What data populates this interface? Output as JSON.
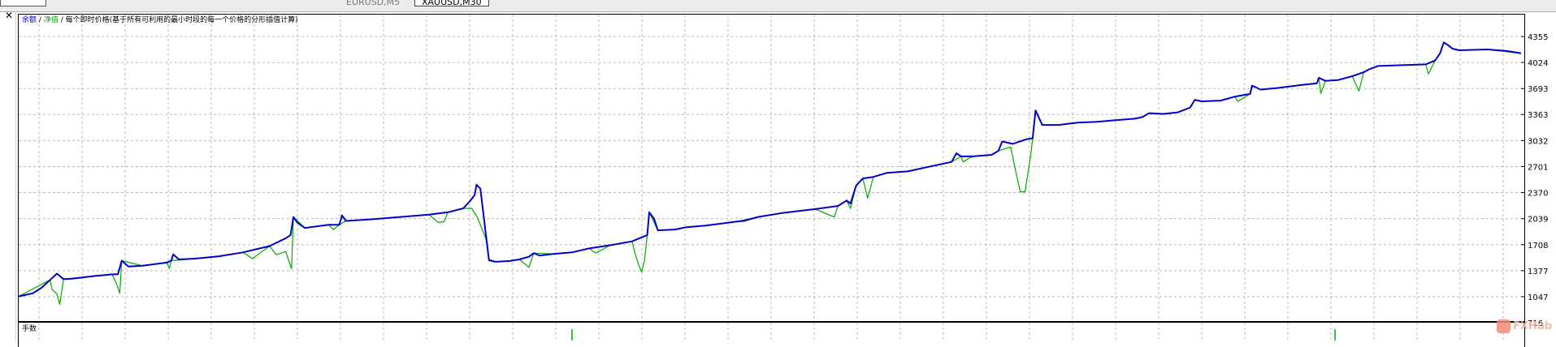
{
  "tabs": [
    {
      "label": "EURUSD,M5",
      "active": false
    },
    {
      "label": "XAUUSD,M30",
      "active": true
    }
  ],
  "close_icon": "✕",
  "legend": {
    "balance_label": "余额",
    "separator": "/",
    "equity_label": "净值",
    "description": "每个即时价格(基于所有可利用的最小时段的每一个价格的分形插值计算)",
    "balance_color": "#0000cc",
    "equity_color": "#00aa00",
    "text_color": "#000000"
  },
  "subwindow": {
    "title": "手数"
  },
  "watermark": {
    "text": "FXHub"
  },
  "chart_data": {
    "type": "line",
    "title": "",
    "xlabel": "",
    "ylabel": "",
    "ylim": [
      716,
      4355
    ],
    "yticks": [
      4355,
      4024,
      3693,
      3363,
      3032,
      2701,
      2370,
      2039,
      1708,
      1377,
      1047,
      716
    ],
    "grid": true,
    "legend_placement": "top-left",
    "x_unit": "trade sequence",
    "xlim": [
      0,
      1000
    ],
    "series": [
      {
        "name": "余额",
        "color": "#0000cc",
        "points": [
          [
            0,
            1050
          ],
          [
            15,
            1090
          ],
          [
            24,
            1160
          ],
          [
            33,
            1260
          ],
          [
            40,
            1340
          ],
          [
            47,
            1270
          ],
          [
            56,
            1275
          ],
          [
            80,
            1310
          ],
          [
            98,
            1330
          ],
          [
            104,
            1330
          ],
          [
            108,
            1505
          ],
          [
            115,
            1430
          ],
          [
            130,
            1440
          ],
          [
            155,
            1480
          ],
          [
            160,
            1505
          ],
          [
            162,
            1585
          ],
          [
            168,
            1520
          ],
          [
            185,
            1530
          ],
          [
            210,
            1560
          ],
          [
            235,
            1610
          ],
          [
            263,
            1690
          ],
          [
            280,
            1790
          ],
          [
            285,
            1830
          ],
          [
            288,
            2060
          ],
          [
            292,
            1990
          ],
          [
            300,
            1920
          ],
          [
            325,
            1960
          ],
          [
            336,
            1960
          ],
          [
            339,
            2080
          ],
          [
            343,
            2010
          ],
          [
            370,
            2030
          ],
          [
            400,
            2060
          ],
          [
            430,
            2090
          ],
          [
            450,
            2120
          ],
          [
            466,
            2170
          ],
          [
            473,
            2260
          ],
          [
            478,
            2340
          ],
          [
            480,
            2470
          ],
          [
            484,
            2420
          ],
          [
            493,
            1510
          ],
          [
            500,
            1490
          ],
          [
            515,
            1500
          ],
          [
            525,
            1520
          ],
          [
            535,
            1555
          ],
          [
            540,
            1600
          ],
          [
            546,
            1570
          ],
          [
            560,
            1590
          ],
          [
            580,
            1610
          ],
          [
            598,
            1660
          ],
          [
            620,
            1700
          ],
          [
            643,
            1750
          ],
          [
            653,
            1800
          ],
          [
            659,
            1830
          ],
          [
            661,
            2120
          ],
          [
            666,
            2040
          ],
          [
            670,
            1890
          ],
          [
            688,
            1900
          ],
          [
            700,
            1930
          ],
          [
            720,
            1950
          ],
          [
            752,
            2000
          ],
          [
            760,
            2010
          ],
          [
            775,
            2060
          ],
          [
            800,
            2110
          ],
          [
            835,
            2160
          ],
          [
            859,
            2200
          ],
          [
            868,
            2270
          ],
          [
            872,
            2230
          ],
          [
            878,
            2460
          ],
          [
            885,
            2550
          ],
          [
            896,
            2570
          ],
          [
            910,
            2620
          ],
          [
            932,
            2640
          ],
          [
            955,
            2700
          ],
          [
            978,
            2760
          ],
          [
            983,
            2870
          ],
          [
            988,
            2830
          ],
          [
            1000,
            2830
          ],
          [
            1020,
            2850
          ],
          [
            1027,
            2900
          ],
          [
            1031,
            3020
          ],
          [
            1042,
            2990
          ],
          [
            1057,
            3050
          ],
          [
            1063,
            3060
          ],
          [
            1066,
            3415
          ],
          [
            1073,
            3230
          ],
          [
            1090,
            3230
          ],
          [
            1110,
            3260
          ],
          [
            1130,
            3270
          ],
          [
            1150,
            3290
          ],
          [
            1170,
            3310
          ],
          [
            1178,
            3330
          ],
          [
            1185,
            3380
          ],
          [
            1200,
            3370
          ],
          [
            1215,
            3390
          ],
          [
            1228,
            3450
          ],
          [
            1233,
            3550
          ],
          [
            1240,
            3530
          ],
          [
            1260,
            3540
          ],
          [
            1275,
            3590
          ],
          [
            1291,
            3625
          ],
          [
            1293,
            3730
          ],
          [
            1302,
            3680
          ],
          [
            1320,
            3700
          ],
          [
            1345,
            3740
          ],
          [
            1361,
            3760
          ],
          [
            1363,
            3830
          ],
          [
            1370,
            3790
          ],
          [
            1383,
            3800
          ],
          [
            1398,
            3850
          ],
          [
            1410,
            3900
          ],
          [
            1416,
            3940
          ],
          [
            1425,
            3980
          ],
          [
            1450,
            3990
          ],
          [
            1475,
            4000
          ],
          [
            1485,
            4050
          ],
          [
            1490,
            4140
          ],
          [
            1494,
            4280
          ],
          [
            1498,
            4250
          ],
          [
            1503,
            4200
          ],
          [
            1510,
            4180
          ],
          [
            1540,
            4190
          ],
          [
            1560,
            4170
          ],
          [
            1571,
            4150
          ],
          [
            1575,
            4140
          ]
        ]
      },
      {
        "name": "净值",
        "color": "#00aa00",
        "points": [
          [
            0,
            1050
          ],
          [
            33,
            1260
          ],
          [
            35,
            1140
          ],
          [
            40,
            1080
          ],
          [
            43,
            950
          ],
          [
            47,
            1270
          ],
          [
            80,
            1310
          ],
          [
            98,
            1330
          ],
          [
            102,
            1230
          ],
          [
            106,
            1090
          ],
          [
            108,
            1505
          ],
          [
            130,
            1440
          ],
          [
            155,
            1480
          ],
          [
            158,
            1410
          ],
          [
            160,
            1505
          ],
          [
            185,
            1530
          ],
          [
            210,
            1560
          ],
          [
            235,
            1610
          ],
          [
            245,
            1530
          ],
          [
            263,
            1690
          ],
          [
            270,
            1580
          ],
          [
            280,
            1620
          ],
          [
            286,
            1400
          ],
          [
            288,
            2060
          ],
          [
            300,
            1920
          ],
          [
            325,
            1960
          ],
          [
            330,
            1900
          ],
          [
            336,
            1960
          ],
          [
            343,
            2010
          ],
          [
            370,
            2030
          ],
          [
            400,
            2060
          ],
          [
            430,
            2090
          ],
          [
            440,
            1990
          ],
          [
            446,
            2000
          ],
          [
            450,
            2120
          ],
          [
            466,
            2170
          ],
          [
            475,
            2170
          ],
          [
            481,
            2050
          ],
          [
            490,
            1780
          ],
          [
            493,
            1520
          ],
          [
            500,
            1490
          ],
          [
            515,
            1500
          ],
          [
            525,
            1520
          ],
          [
            535,
            1420
          ],
          [
            540,
            1600
          ],
          [
            560,
            1590
          ],
          [
            580,
            1610
          ],
          [
            598,
            1660
          ],
          [
            605,
            1600
          ],
          [
            620,
            1700
          ],
          [
            643,
            1750
          ],
          [
            646,
            1600
          ],
          [
            650,
            1450
          ],
          [
            653,
            1360
          ],
          [
            656,
            1500
          ],
          [
            659,
            1830
          ],
          [
            661,
            2120
          ],
          [
            670,
            1890
          ],
          [
            688,
            1900
          ],
          [
            700,
            1930
          ],
          [
            720,
            1950
          ],
          [
            752,
            2000
          ],
          [
            775,
            2060
          ],
          [
            800,
            2110
          ],
          [
            835,
            2160
          ],
          [
            855,
            2060
          ],
          [
            859,
            2200
          ],
          [
            868,
            2270
          ],
          [
            872,
            2170
          ],
          [
            878,
            2460
          ],
          [
            885,
            2550
          ],
          [
            890,
            2300
          ],
          [
            896,
            2570
          ],
          [
            910,
            2620
          ],
          [
            932,
            2640
          ],
          [
            955,
            2700
          ],
          [
            978,
            2760
          ],
          [
            988,
            2830
          ],
          [
            990,
            2760
          ],
          [
            1000,
            2830
          ],
          [
            1020,
            2850
          ],
          [
            1027,
            2900
          ],
          [
            1040,
            2950
          ],
          [
            1045,
            2650
          ],
          [
            1050,
            2380
          ],
          [
            1055,
            2380
          ],
          [
            1061,
            2850
          ],
          [
            1066,
            3415
          ],
          [
            1073,
            3230
          ],
          [
            1090,
            3230
          ],
          [
            1110,
            3260
          ],
          [
            1130,
            3270
          ],
          [
            1150,
            3290
          ],
          [
            1170,
            3310
          ],
          [
            1178,
            3330
          ],
          [
            1185,
            3380
          ],
          [
            1200,
            3370
          ],
          [
            1215,
            3390
          ],
          [
            1228,
            3450
          ],
          [
            1233,
            3550
          ],
          [
            1240,
            3530
          ],
          [
            1260,
            3540
          ],
          [
            1275,
            3590
          ],
          [
            1278,
            3530
          ],
          [
            1291,
            3625
          ],
          [
            1293,
            3730
          ],
          [
            1302,
            3680
          ],
          [
            1320,
            3700
          ],
          [
            1345,
            3740
          ],
          [
            1361,
            3760
          ],
          [
            1363,
            3830
          ],
          [
            1365,
            3630
          ],
          [
            1370,
            3790
          ],
          [
            1383,
            3800
          ],
          [
            1398,
            3850
          ],
          [
            1405,
            3660
          ],
          [
            1410,
            3900
          ],
          [
            1416,
            3940
          ],
          [
            1425,
            3980
          ],
          [
            1450,
            3990
          ],
          [
            1475,
            4000
          ],
          [
            1478,
            3880
          ],
          [
            1485,
            4050
          ],
          [
            1490,
            4140
          ],
          [
            1494,
            4280
          ],
          [
            1503,
            4200
          ],
          [
            1510,
            4180
          ],
          [
            1540,
            4190
          ],
          [
            1575,
            4140
          ]
        ]
      }
    ],
    "lots_spikes_x": [
      580,
      1380
    ]
  }
}
